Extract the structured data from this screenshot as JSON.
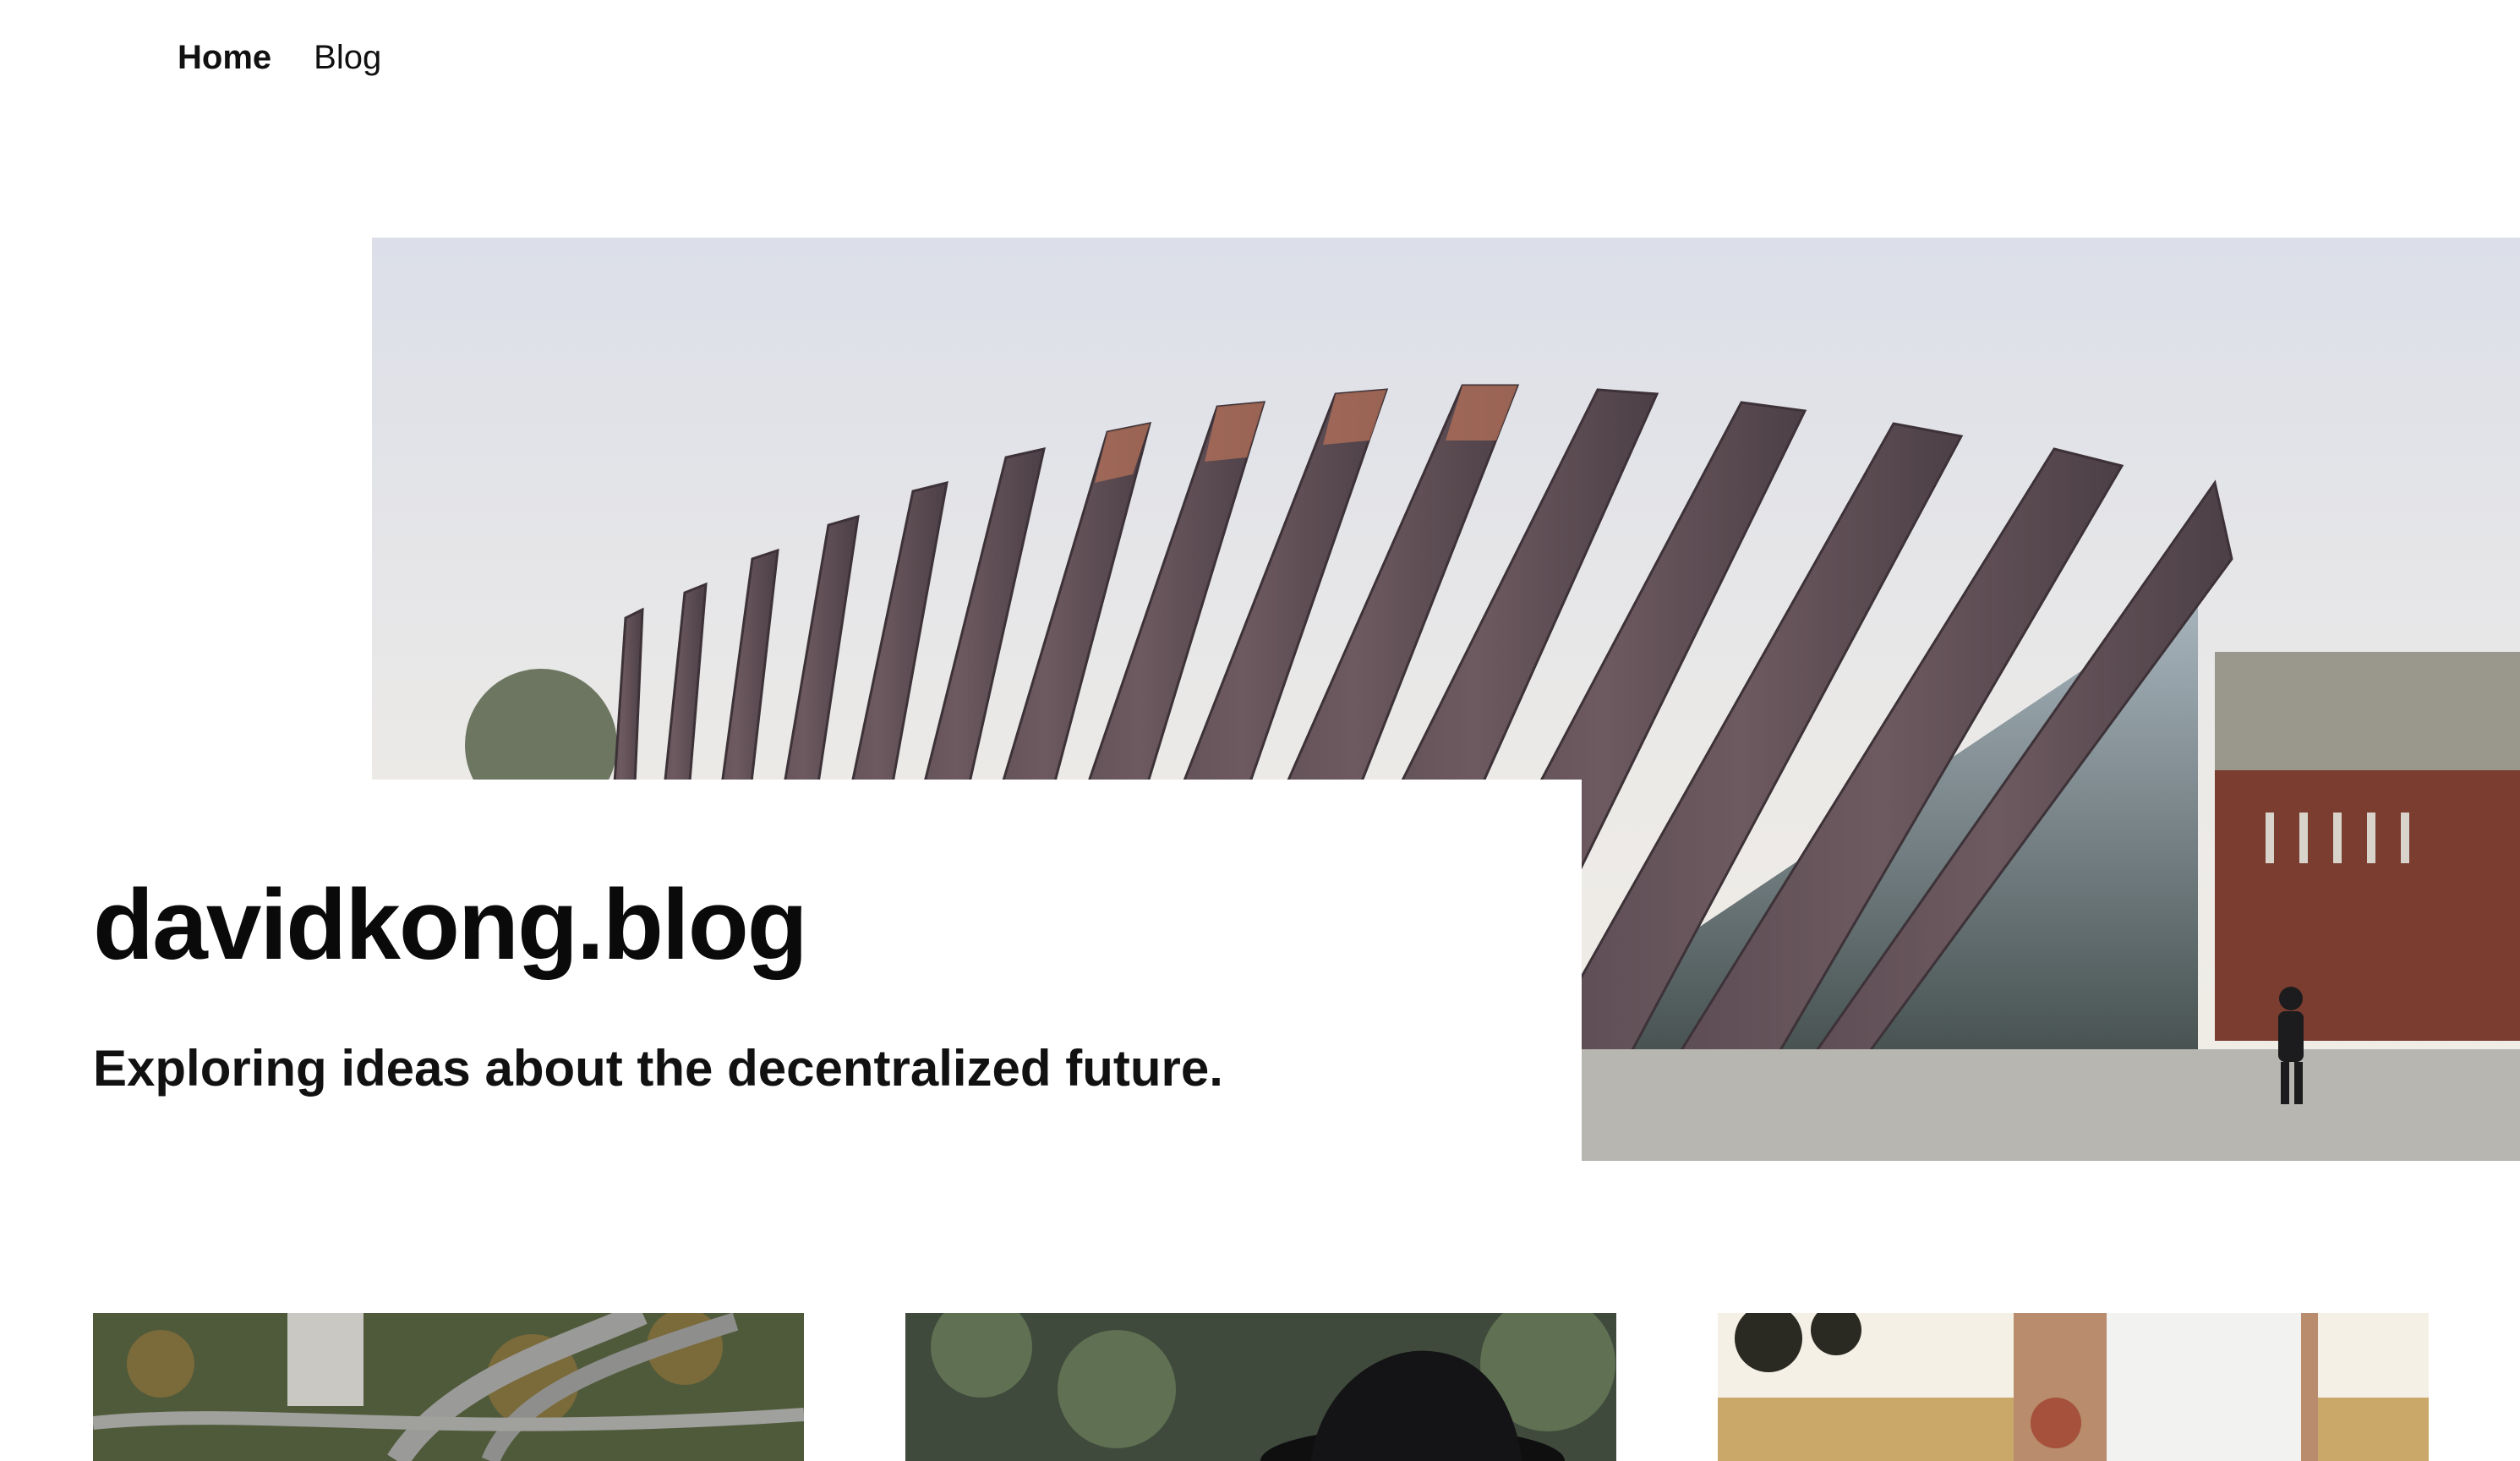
{
  "nav": {
    "items": [
      {
        "label": "Home",
        "active": true
      },
      {
        "label": "Blog",
        "active": false
      }
    ]
  },
  "hero": {
    "title": "davidkong.blog",
    "tagline": "Exploring ideas about the decentralized future.",
    "image_subject": "modern building with angled copper fins"
  },
  "posts": {
    "thumbnails": [
      {
        "subject": "aerial view of highway interchange and trees"
      },
      {
        "subject": "person in black hat among foliage"
      },
      {
        "subject": "tattooed arm and white shirt in sunlit field"
      }
    ]
  },
  "colors": {
    "text": "#0a0a0a",
    "background": "#ffffff",
    "copper": "#8a5a4a",
    "sky": "#dfe2ea",
    "brick": "#7a3d2f"
  }
}
